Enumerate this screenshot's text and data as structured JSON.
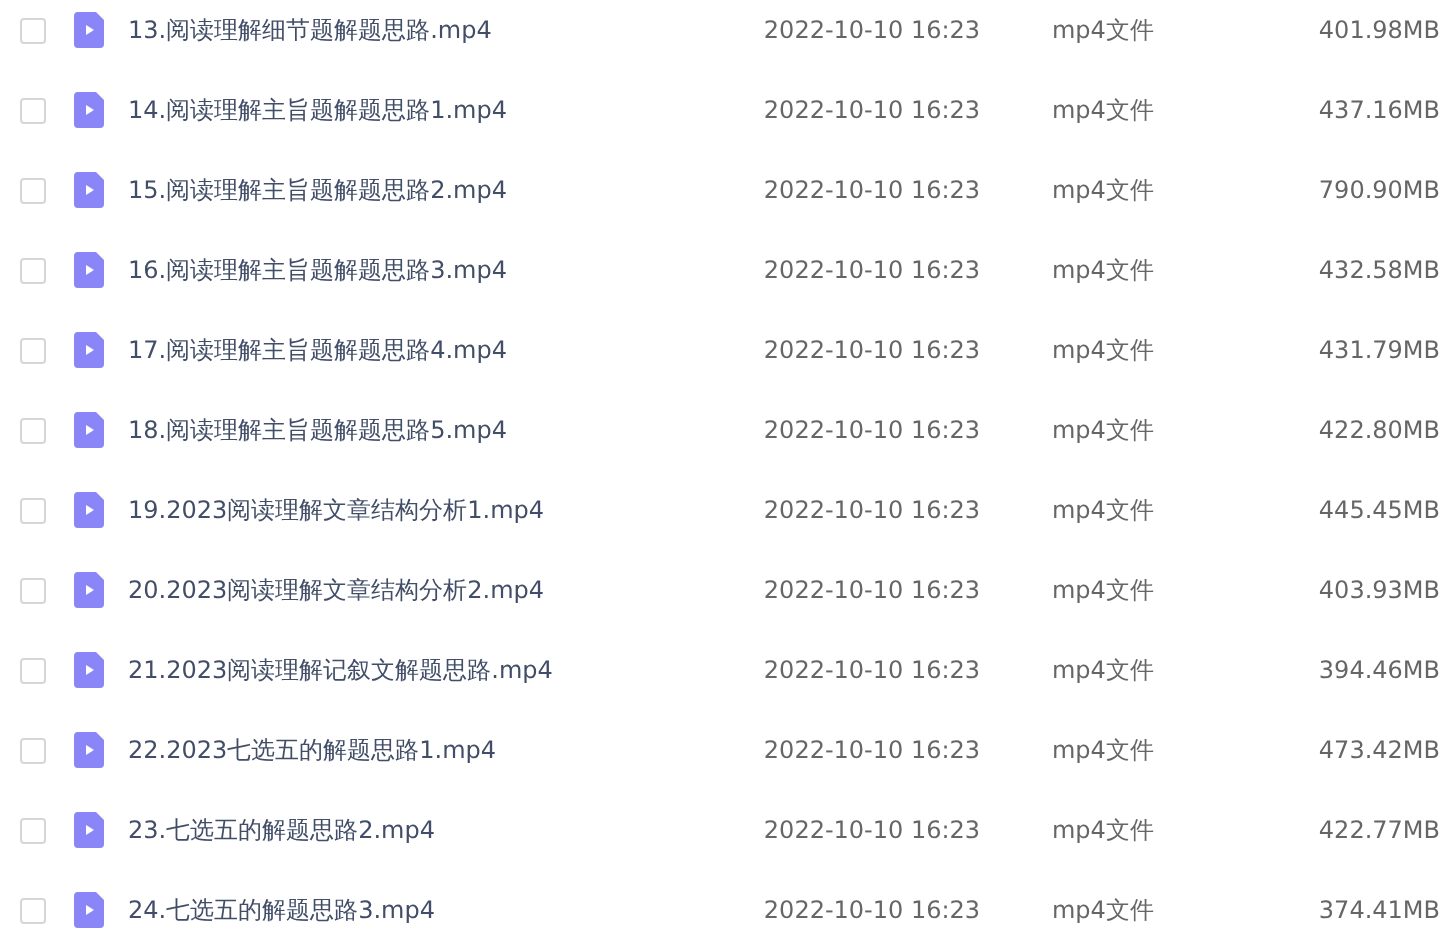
{
  "files": [
    {
      "name": "13.阅读理解细节题解题思路.mp4",
      "modified": "2022-10-10 16:23",
      "type": "mp4文件",
      "size": "401.98MB",
      "checked": false
    },
    {
      "name": "14.阅读理解主旨题解题思路1.mp4",
      "modified": "2022-10-10 16:23",
      "type": "mp4文件",
      "size": "437.16MB",
      "checked": false
    },
    {
      "name": "15.阅读理解主旨题解题思路2.mp4",
      "modified": "2022-10-10 16:23",
      "type": "mp4文件",
      "size": "790.90MB",
      "checked": false
    },
    {
      "name": "16.阅读理解主旨题解题思路3.mp4",
      "modified": "2022-10-10 16:23",
      "type": "mp4文件",
      "size": "432.58MB",
      "checked": false
    },
    {
      "name": "17.阅读理解主旨题解题思路4.mp4",
      "modified": "2022-10-10 16:23",
      "type": "mp4文件",
      "size": "431.79MB",
      "checked": false
    },
    {
      "name": "18.阅读理解主旨题解题思路5.mp4",
      "modified": "2022-10-10 16:23",
      "type": "mp4文件",
      "size": "422.80MB",
      "checked": false
    },
    {
      "name": "19.2023阅读理解文章结构分析1.mp4",
      "modified": "2022-10-10 16:23",
      "type": "mp4文件",
      "size": "445.45MB",
      "checked": false
    },
    {
      "name": "20.2023阅读理解文章结构分析2.mp4",
      "modified": "2022-10-10 16:23",
      "type": "mp4文件",
      "size": "403.93MB",
      "checked": false
    },
    {
      "name": "21.2023阅读理解记叙文解题思路.mp4",
      "modified": "2022-10-10 16:23",
      "type": "mp4文件",
      "size": "394.46MB",
      "checked": false
    },
    {
      "name": "22.2023七选五的解题思路1.mp4",
      "modified": "2022-10-10 16:23",
      "type": "mp4文件",
      "size": "473.42MB",
      "checked": false
    },
    {
      "name": "23.七选五的解题思路2.mp4",
      "modified": "2022-10-10 16:23",
      "type": "mp4文件",
      "size": "422.77MB",
      "checked": false
    },
    {
      "name": "24.七选五的解题思路3.mp4",
      "modified": "2022-10-10 16:23",
      "type": "mp4文件",
      "size": "374.41MB",
      "checked": false
    }
  ]
}
